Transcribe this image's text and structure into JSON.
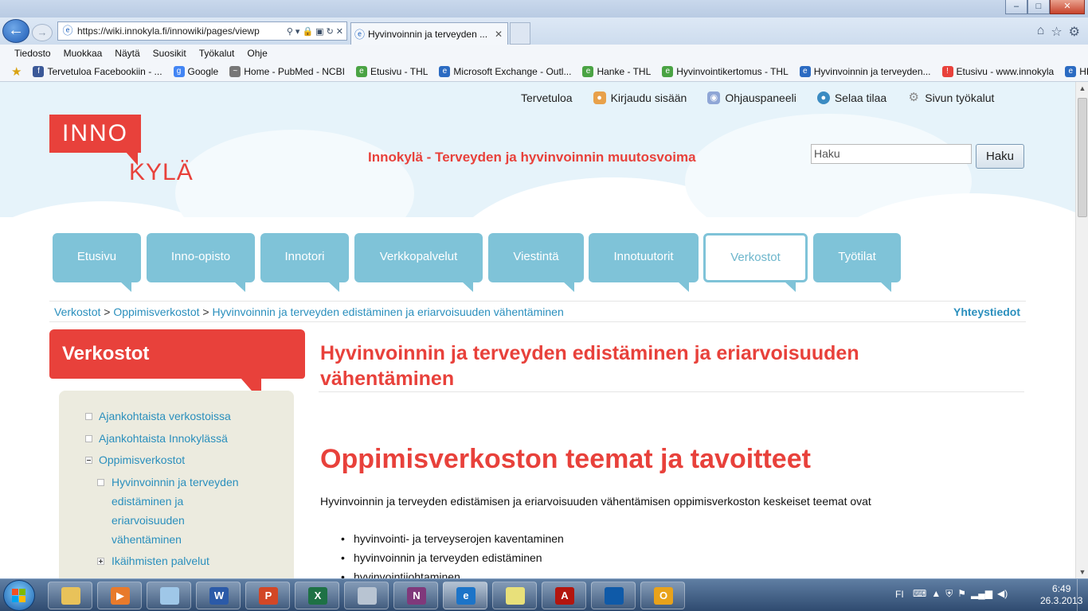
{
  "window": {
    "minimize": "–",
    "maximize": "□",
    "close": "✕"
  },
  "navbar": {
    "back_icon": "arrow-left",
    "forward_icon": "arrow-right",
    "url": "https://wiki.innokyla.fi/innowiki/pages/viewp",
    "tab_title": "Hyvinvoinnin ja terveyden ...",
    "tab_close": "✕",
    "right_icons": [
      "home-icon",
      "star-icon",
      "gear-icon"
    ]
  },
  "menubar": [
    "Tiedosto",
    "Muokkaa",
    "Näytä",
    "Suosikit",
    "Työkalut",
    "Ohje"
  ],
  "favorites": [
    {
      "label": "Tervetuloa Facebookiin - ...",
      "icon": "f",
      "color": "#3b5998"
    },
    {
      "label": "Google",
      "icon": "g",
      "color": "#4285f4"
    },
    {
      "label": "Home - PubMed - NCBI",
      "icon": "~",
      "color": "#777777"
    },
    {
      "label": "Etusivu - THL",
      "icon": "e",
      "color": "#4aa344"
    },
    {
      "label": "Microsoft Exchange - Outl...",
      "icon": "e",
      "color": "#2b6bc2"
    },
    {
      "label": "Hanke - THL",
      "icon": "e",
      "color": "#4aa344"
    },
    {
      "label": "Hyvinvointikertomus - THL",
      "icon": "e",
      "color": "#4aa344"
    },
    {
      "label": "Hyvinvoinnin ja terveyden...",
      "icon": "e",
      "color": "#2b6bc2"
    },
    {
      "label": "Etusivu - www.innokyla",
      "icon": "!",
      "color": "#e8413b"
    },
    {
      "label": "HPH",
      "icon": "e",
      "color": "#2b6bc2"
    }
  ],
  "header": {
    "toplinks": [
      {
        "label": "Tervetuloa",
        "icon": ""
      },
      {
        "label": "Kirjaudu sisään",
        "icon": "user-icon"
      },
      {
        "label": "Ohjauspaneeli",
        "icon": "panel-icon"
      },
      {
        "label": "Selaa tilaa",
        "icon": "globe-icon"
      },
      {
        "label": "Sivun työkalut",
        "icon": "gear-icon"
      }
    ],
    "logo_top": "INNO",
    "logo_bottom": "KYLÄ",
    "slogan": "Innokylä - Terveyden ja hyvinvoinnin muutosvoima",
    "search_placeholder": "Haku",
    "search_button": "Haku"
  },
  "nav_tabs": [
    {
      "label": "Etusivu",
      "active": false
    },
    {
      "label": "Inno-opisto",
      "active": false
    },
    {
      "label": "Innotori",
      "active": false
    },
    {
      "label": "Verkkopalvelut",
      "active": false
    },
    {
      "label": "Viestintä",
      "active": false
    },
    {
      "label": "Innotuutorit",
      "active": false
    },
    {
      "label": "Verkostot",
      "active": true
    },
    {
      "label": "Työtilat",
      "active": false
    }
  ],
  "breadcrumb": {
    "items": [
      "Verkostot",
      "Oppimisverkostot",
      "Hyvinvoinnin ja terveyden edistäminen ja eriarvoisuuden vähentäminen"
    ],
    "separator": ">",
    "contact": "Yhteystiedot"
  },
  "sidebar": {
    "title": "Verkostot",
    "items": [
      {
        "label": "Ajankohtaista verkostoissa",
        "type": "box"
      },
      {
        "label": "Ajankohtaista Innokylässä",
        "type": "box"
      },
      {
        "label": "Oppimisverkostot",
        "type": "minus"
      },
      {
        "label_lines": [
          "Hyvinvoinnin ja terveyden",
          "edistäminen ja",
          "eriarvoisuuden",
          "vähentäminen"
        ],
        "type": "box"
      },
      {
        "label": "Ikäihmisten palvelut",
        "type": "plus"
      }
    ]
  },
  "content": {
    "title": "Hyvinvoinnin ja terveyden edistäminen ja eriarvoisuuden vähentäminen",
    "h1": "Oppimisverkoston teemat ja tavoitteet",
    "intro": "Hyvinvoinnin ja terveyden edistämisen ja eriarvoisuuden vähentämisen oppimisverkoston keskeiset teemat ovat",
    "list": [
      "hyvinvointi- ja terveyserojen kaventaminen",
      "hyvinvoinnin ja terveyden edistäminen",
      "hyvinvointijohtaminen"
    ]
  },
  "taskbar": {
    "apps": [
      {
        "name": "explorer",
        "glyph": "",
        "color": "#e8c25a"
      },
      {
        "name": "media-player",
        "glyph": "▶",
        "color": "#e87a2b"
      },
      {
        "name": "notes",
        "glyph": "",
        "color": "#9fc7e8"
      },
      {
        "name": "word",
        "glyph": "W",
        "color": "#2b5aa8"
      },
      {
        "name": "powerpoint",
        "glyph": "P",
        "color": "#d24726"
      },
      {
        "name": "excel",
        "glyph": "X",
        "color": "#1e7145"
      },
      {
        "name": "calculator",
        "glyph": "",
        "color": "#b8c4d2"
      },
      {
        "name": "onenote",
        "glyph": "N",
        "color": "#80397b"
      },
      {
        "name": "internet-explorer",
        "glyph": "e",
        "color": "#1c74c8"
      },
      {
        "name": "sticky-notes",
        "glyph": "",
        "color": "#e8e07a"
      },
      {
        "name": "acrobat",
        "glyph": "A",
        "color": "#b3150e"
      },
      {
        "name": "globe",
        "glyph": "",
        "color": "#0f5aa8"
      },
      {
        "name": "outlook",
        "glyph": "O",
        "color": "#e8a21b"
      }
    ],
    "lang": "FI",
    "time": "6:49",
    "date": "26.3.2013"
  }
}
